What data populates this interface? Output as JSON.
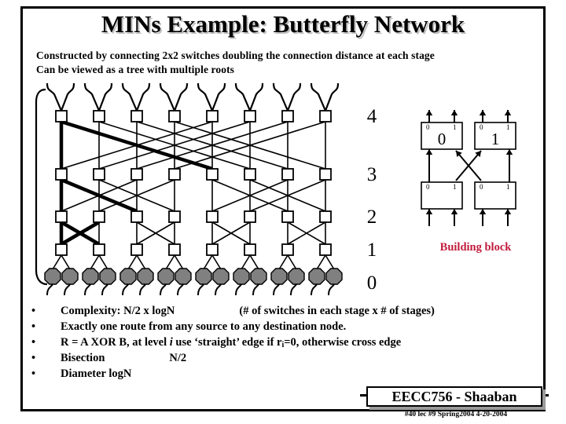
{
  "slide": {
    "title": "MINs Example: Butterfly Network",
    "subtitle_lines": [
      "Constructed by connecting 2x2 switches doubling the connection distance at each stage",
      "Can be viewed as a tree with multiple roots"
    ]
  },
  "network": {
    "level_labels": [
      "4",
      "3",
      "2",
      "1",
      "0"
    ],
    "num_columns": 8,
    "num_switch_rows": 4,
    "num_terminals": 16,
    "stage_distances": [
      4,
      2,
      1
    ],
    "switch_fill": "#ffffff",
    "switch_stroke": "#000000",
    "terminal_fill": "#808080",
    "wire_color": "#000000"
  },
  "building_block": {
    "caption": "Building block",
    "caption_color": "#c21b3c",
    "top_box_labels": [
      "0",
      "1"
    ],
    "port_labels": [
      "0",
      "1",
      "0",
      "1"
    ],
    "bottom_port_labels": [
      "0",
      "1",
      "0",
      "1"
    ]
  },
  "bullets": [
    {
      "marker": "•",
      "segments": [
        {
          "text": "Complexity:  N/2 x logN"
        },
        {
          "gap": "lg"
        },
        {
          "text": "(# of switches in each stage x # of stages)"
        }
      ]
    },
    {
      "marker": "•",
      "segments": [
        {
          "text": "Exactly one route from any source to any destination node."
        }
      ]
    },
    {
      "marker": "•",
      "segments": [
        {
          "text": "R = A XOR  B, at level "
        },
        {
          "text": "i",
          "italic": true
        },
        {
          "text": " use ‘straight’ edge if r"
        },
        {
          "text": "i",
          "sub": true
        },
        {
          "text": "=0, otherwise cross edge"
        }
      ]
    },
    {
      "marker": "•",
      "segments": [
        {
          "text": "Bisection"
        },
        {
          "gap": "lg"
        },
        {
          "text": "N/2"
        }
      ]
    },
    {
      "marker": "•",
      "segments": [
        {
          "text": "Diameter logN"
        }
      ]
    }
  ],
  "footer": {
    "badge_text": "EECC756 - Shaaban",
    "sub_text": "#40  lec #9   Spring2004   4-20-2004"
  }
}
